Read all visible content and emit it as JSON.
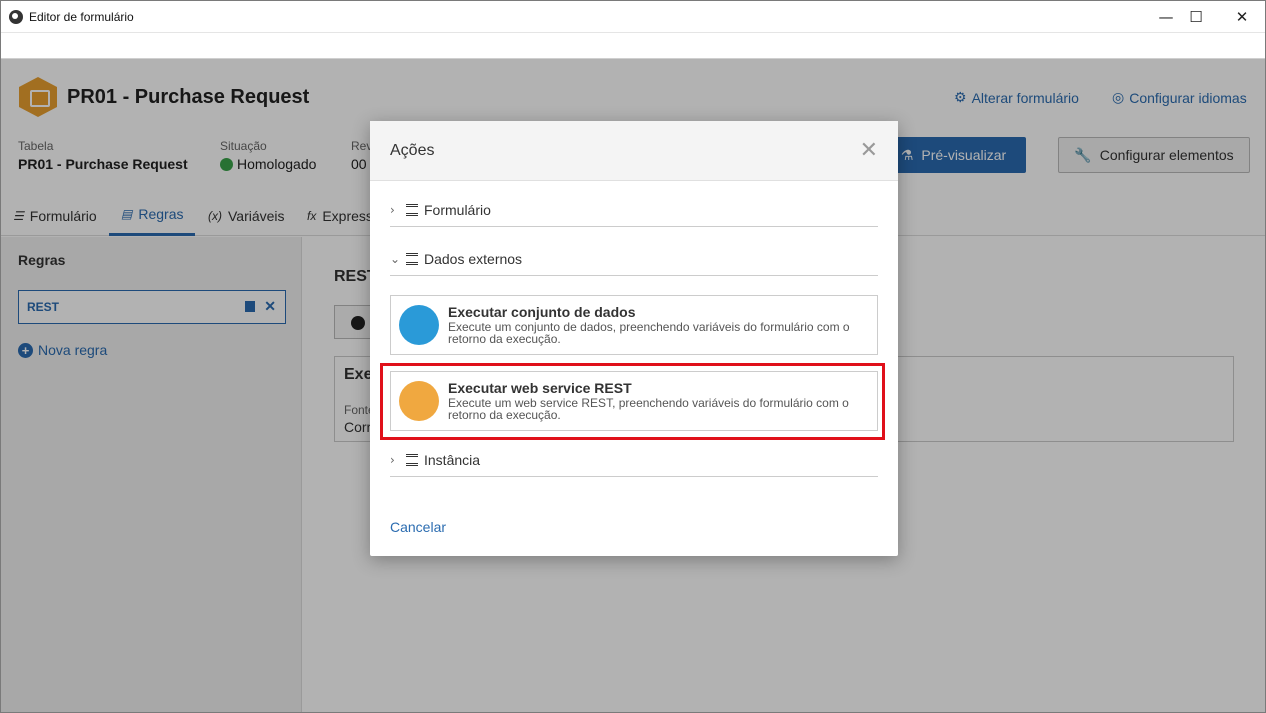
{
  "window": {
    "title": "Editor de formulário",
    "minimize": "—",
    "maximize": "☐",
    "close": "✕"
  },
  "header": {
    "title": "PR01 - Purchase Request",
    "alter_link": "Alterar formulário",
    "lang_link": "Configurar idiomas"
  },
  "meta": {
    "table_label": "Tabela",
    "table_value": "PR01 - Purchase Request",
    "status_label": "Situação",
    "status_value": "Homologado",
    "rev_label": "Rev",
    "rev_value": "00"
  },
  "buttons": {
    "preview": "Pré-visualizar",
    "configure": "Configurar elementos"
  },
  "tabs": [
    {
      "label": "Formulário",
      "icon": "☰"
    },
    {
      "label": "Regras",
      "icon": "▤"
    },
    {
      "label": "Variáveis",
      "icon": "(x)"
    },
    {
      "label": "Express",
      "icon": "fx"
    }
  ],
  "rules_panel": {
    "heading": "Regras",
    "rule_name": "REST",
    "new_rule": "Nova regra"
  },
  "rule_detail": {
    "title": "REST",
    "card_title": "Exe",
    "source_label": "Fonte",
    "source_value": "Corr"
  },
  "modal": {
    "title": "Ações",
    "sections": [
      "Formulário",
      "Dados externos",
      "Instância"
    ],
    "cards": [
      {
        "title": "Executar conjunto de dados",
        "desc": "Execute um conjunto de dados, preenchendo variáveis do formulário com o retorno da execução."
      },
      {
        "title": "Executar web service REST",
        "desc": "Execute um web service REST, preenchendo variáveis do formulário com o retorno da execução."
      }
    ],
    "cancel": "Cancelar"
  },
  "colors": {
    "accent": "#2a6bb0",
    "highlight": "#e0101a",
    "logo": "#e8a030",
    "status_ok": "#3aa34a"
  }
}
